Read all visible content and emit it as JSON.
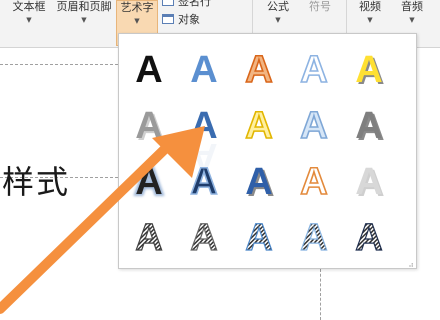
{
  "ribbon": {
    "textbox_label": "文本框",
    "header_footer_label": "页眉和页脚",
    "wordart_label": "艺术字",
    "signature_line_label": "签名行",
    "object_label": "对象",
    "equation_label": "公式",
    "symbol_label": "符号",
    "video_label": "视频",
    "audio_label": "音频",
    "dropdown_glyph": "▼"
  },
  "document": {
    "body_text": "样式"
  },
  "wordart_gallery": {
    "glyph": "A",
    "resize_grip": "⣠",
    "styles": [
      {
        "fill": "#111111",
        "stroke": "none",
        "effect": "plain"
      },
      {
        "fill": "#5b8fd0",
        "stroke": "none",
        "effect": "plain"
      },
      {
        "fill": "#f2b582",
        "stroke": "#d9661a",
        "effect": "outline"
      },
      {
        "fill": "#ffffff",
        "stroke": "#8db3e2",
        "effect": "outline"
      },
      {
        "fill": "#ffe033",
        "stroke": "#c79a00",
        "effect": "bevel"
      },
      {
        "fill": "#9a9a9a",
        "stroke": "none",
        "effect": "shadow"
      },
      {
        "fill": "#3a6cb0",
        "stroke": "none",
        "effect": "reflect"
      },
      {
        "fill": "#fff0a0",
        "stroke": "#e2b600",
        "effect": "outline"
      },
      {
        "fill": "#d6e6f7",
        "stroke": "#7fa7d6",
        "effect": "outline"
      },
      {
        "fill": "#7f7f7f",
        "stroke": "none",
        "effect": "bevel"
      },
      {
        "fill": "#222222",
        "stroke": "none",
        "effect": "glow"
      },
      {
        "fill": "#1f3d6b",
        "stroke": "#8fb3e0",
        "effect": "outline"
      },
      {
        "fill": "#2f5fa8",
        "stroke": "none",
        "effect": "bevel"
      },
      {
        "fill": "#ffffff",
        "stroke": "#e38a3c",
        "effect": "outline"
      },
      {
        "fill": "#d8d8d8",
        "stroke": "none",
        "effect": "shadow"
      },
      {
        "fill": "#444444",
        "stroke": "none",
        "effect": "stripes"
      },
      {
        "fill": "#666666",
        "stroke": "none",
        "effect": "stripes"
      },
      {
        "fill": "#4a86c8",
        "stroke": "none",
        "effect": "stripes"
      },
      {
        "fill": "#86b2e0",
        "stroke": "none",
        "effect": "stripes"
      },
      {
        "fill": "#1f2f4f",
        "stroke": "none",
        "effect": "stripes"
      }
    ]
  },
  "annotation": {
    "arrow_color": "#f5903e"
  }
}
